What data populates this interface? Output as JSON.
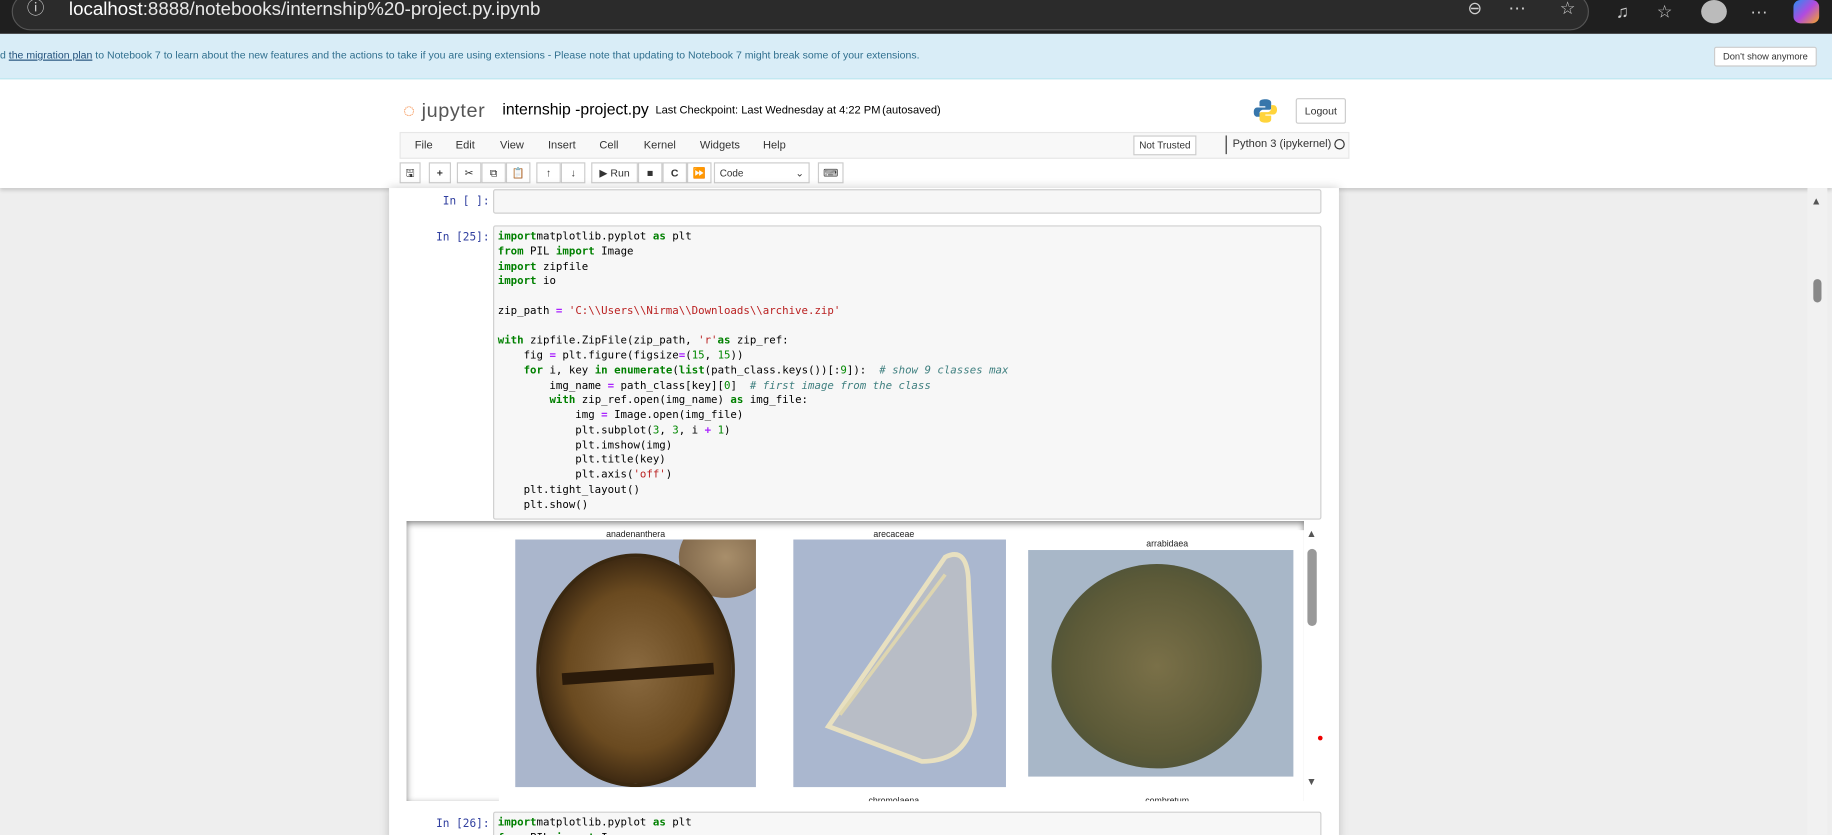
{
  "browser": {
    "url_host": "localhost",
    "url_rest": ":8888/notebooks/internship%20-project.py.ipynb",
    "icons": [
      "info-icon",
      "zoom-out-icon",
      "more-options-icon",
      "favorite-star-icon",
      "read-aloud-icon",
      "favorites-icon",
      "profile-icon",
      "menu-icon",
      "copilot-icon"
    ]
  },
  "banner": {
    "prefix": "d ",
    "link": "the migration plan",
    "text": " to Notebook 7 to learn about the new features and the actions to take if you are using extensions - Please note that updating to Notebook 7 might break some of your extensions.",
    "dismiss": "Don't show anymore",
    "bg": "#d9edf7"
  },
  "header": {
    "logo": "jupyter",
    "notebook_name": "internship -project.py",
    "checkpoint": "Last Checkpoint: Last Wednesday at 4:22 PM",
    "autosave": "(autosaved)",
    "logout": "Logout"
  },
  "menu": {
    "items": [
      "File",
      "Edit",
      "View",
      "Insert",
      "Cell",
      "Kernel",
      "Widgets",
      "Help"
    ],
    "trusted": "Not Trusted",
    "kernel": "Python 3 (ipykernel)"
  },
  "toolbar": {
    "run": "Run",
    "cell_type": "Code"
  },
  "cells": [
    {
      "prompt": "In [ ]:"
    },
    {
      "prompt": "In [25]:",
      "lines": [
        [
          [
            "kw",
            "import"
          ],
          [
            "",
            "matplotlib.pyplot "
          ],
          [
            "kw",
            "as"
          ],
          [
            "",
            " plt"
          ]
        ],
        [
          [
            "kw",
            "from"
          ],
          [
            "",
            " PIL "
          ],
          [
            "kw",
            "import"
          ],
          [
            "",
            " Image"
          ]
        ],
        [
          [
            "kw",
            "import"
          ],
          [
            "",
            " zipfile"
          ]
        ],
        [
          [
            "kw",
            "import"
          ],
          [
            "",
            " io"
          ]
        ],
        [],
        [
          [
            "",
            "zip_path "
          ],
          [
            "op",
            "="
          ],
          [
            "",
            " "
          ],
          [
            "st",
            "'C:\\\\Users\\\\Nirma\\\\Downloads\\\\archive.zip'"
          ]
        ],
        [],
        [
          [
            "kw",
            "with"
          ],
          [
            "",
            " zipfile.ZipFile(zip_path, "
          ],
          [
            "st",
            "'r'"
          ],
          [
            ") "
          ],
          [
            "kw",
            "as"
          ],
          [
            "",
            " zip_ref:"
          ]
        ],
        [
          [
            "",
            "    fig "
          ],
          [
            "op",
            "="
          ],
          [
            "",
            " plt.figure(figsize"
          ],
          [
            "op",
            "="
          ],
          [
            "",
            "("
          ],
          [
            "nu",
            "15"
          ],
          [
            "",
            ", "
          ],
          [
            "nu",
            "15"
          ],
          [
            "",
            "))"
          ]
        ],
        [
          [
            "",
            "    "
          ],
          [
            "kw",
            "for"
          ],
          [
            "",
            " i, key "
          ],
          [
            "kw",
            "in"
          ],
          [
            "",
            " "
          ],
          [
            "kw",
            "enumerate"
          ],
          [
            "",
            "("
          ],
          [
            "kw",
            "list"
          ],
          [
            "",
            "(path_class.keys())[:"
          ],
          [
            "nu",
            "9"
          ],
          [
            "",
            "]):  "
          ],
          [
            "cm",
            "# show 9 classes max"
          ]
        ],
        [
          [
            "",
            "        img_name "
          ],
          [
            "op",
            "="
          ],
          [
            "",
            " path_class[key]["
          ],
          [
            "nu",
            "0"
          ],
          [
            "",
            "]  "
          ],
          [
            "cm",
            "# first image from the class"
          ]
        ],
        [
          [
            "",
            "        "
          ],
          [
            "kw",
            "with"
          ],
          [
            "",
            " zip_ref.open(img_name) "
          ],
          [
            "kw",
            "as"
          ],
          [
            "",
            " img_file:"
          ]
        ],
        [
          [
            "",
            "            img "
          ],
          [
            "op",
            "="
          ],
          [
            "",
            " Image.open(img_file)"
          ]
        ],
        [
          [
            "",
            "            plt.subplot("
          ],
          [
            "nu",
            "3"
          ],
          [
            "",
            ", "
          ],
          [
            "nu",
            "3"
          ],
          [
            "",
            ", i "
          ],
          [
            "op",
            "+"
          ],
          [
            "",
            " "
          ],
          [
            "nu",
            "1"
          ],
          [
            "",
            ")"
          ]
        ],
        [
          [
            "",
            "            plt.imshow(img)"
          ]
        ],
        [
          [
            "",
            "            plt.title(key)"
          ]
        ],
        [
          [
            "",
            "            plt.axis("
          ],
          [
            "st",
            "'off'"
          ],
          [
            "",
            ")"
          ]
        ],
        [
          [
            "",
            "    plt.tight_layout()"
          ]
        ],
        [
          [
            "",
            "    plt.show()"
          ]
        ]
      ],
      "output_titles": [
        "anadenanthera",
        "arecaceae",
        "arrabidaea",
        "chromolaena",
        "combretum"
      ]
    },
    {
      "prompt": "In [26]:",
      "lines": [
        [
          [
            "kw",
            "import"
          ],
          [
            "",
            "matplotlib.pyplot "
          ],
          [
            "kw",
            "as"
          ],
          [
            "",
            " plt"
          ]
        ],
        [
          [
            "kw",
            "from"
          ],
          [
            "",
            " PIL "
          ],
          [
            "kw",
            "import"
          ],
          [
            "",
            " Image"
          ]
        ]
      ]
    }
  ]
}
